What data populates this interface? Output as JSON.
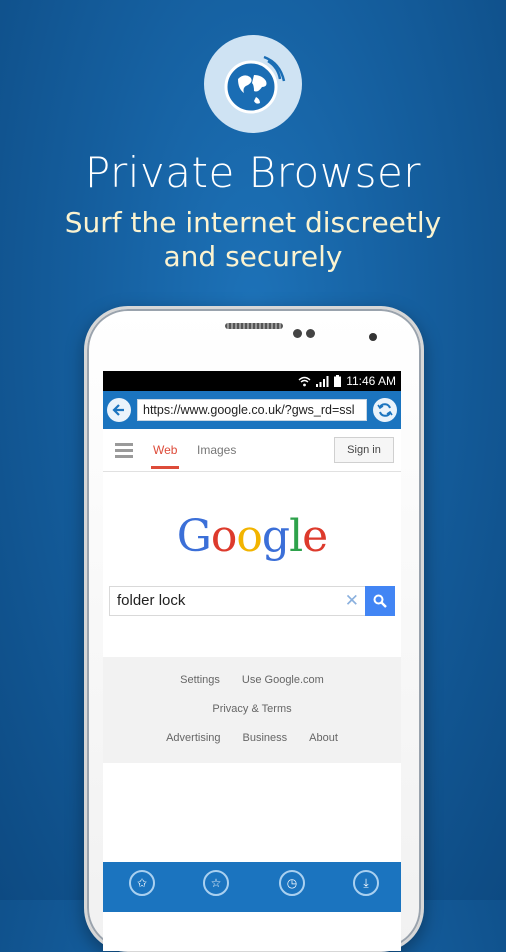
{
  "hero": {
    "title": "Private Browser",
    "subtitle": "Surf the internet discreetly and securely"
  },
  "phone": {
    "status_bar": {
      "time": "11:46 AM"
    },
    "browser": {
      "url": "https://www.google.co.uk/?gws_rd=ssl"
    },
    "google_page": {
      "tabs": [
        "Web",
        "Images"
      ],
      "sign_in_label": "Sign in",
      "logo_letters": [
        "G",
        "o",
        "o",
        "g",
        "l",
        "e"
      ],
      "logo_colors": [
        "#3b6fd8",
        "#dd3a2c",
        "#f2b400",
        "#3b6fd8",
        "#2ea24b",
        "#dd3a2c"
      ],
      "search_value": "folder lock",
      "footer_links": {
        "row1": [
          "Settings",
          "Use Google.com"
        ],
        "row2": [
          "Privacy & Terms"
        ],
        "row3": [
          "Advertising",
          "Business",
          "About"
        ]
      }
    }
  },
  "colors": {
    "accent": "#1b74bf",
    "google_red": "#dd4b39",
    "google_blue": "#4285f4"
  }
}
